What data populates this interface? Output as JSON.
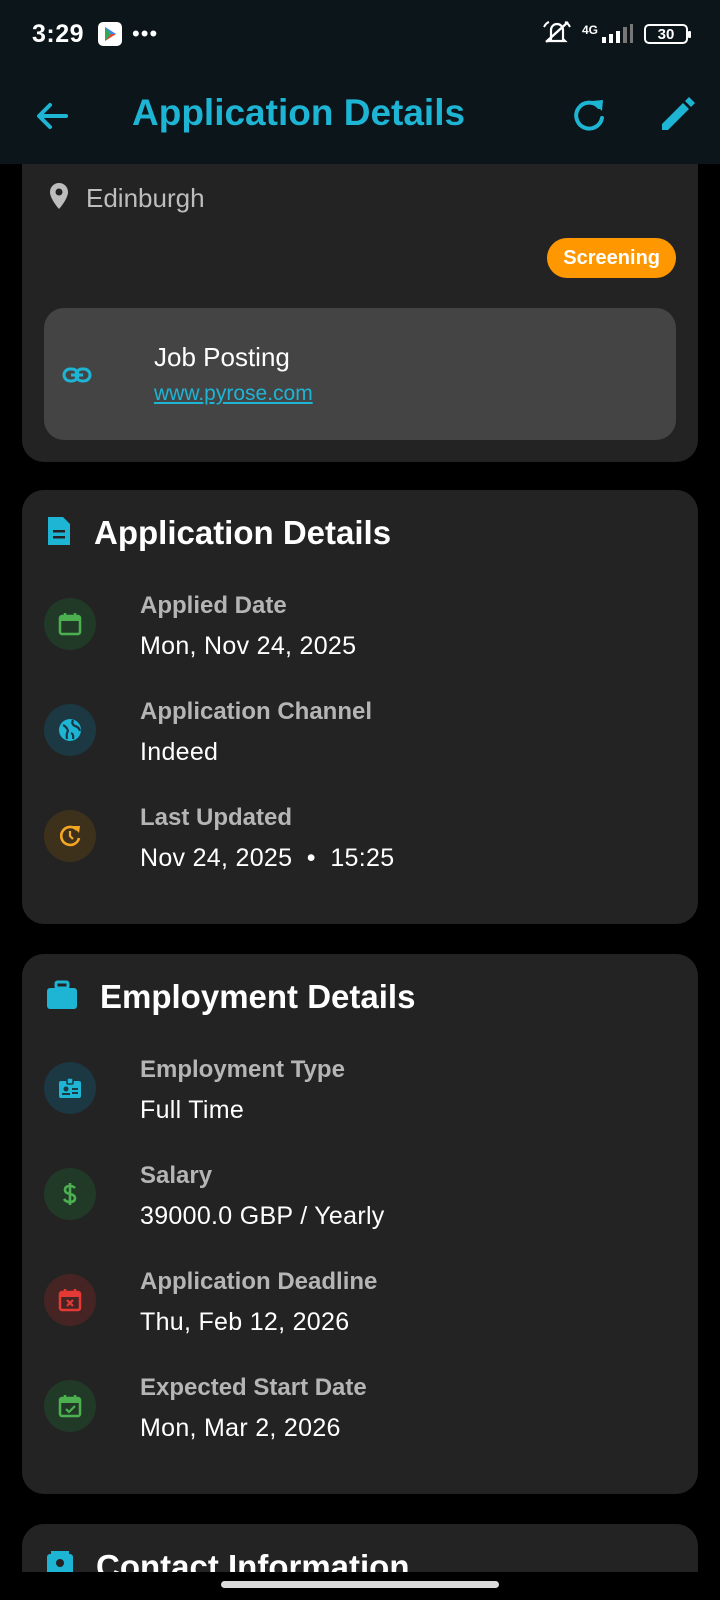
{
  "status_bar": {
    "time": "3:29",
    "dots": "•••",
    "network": "4G",
    "battery": "30"
  },
  "header": {
    "title": "Application Details"
  },
  "job_card": {
    "location": "Edinburgh",
    "status_badge": "Screening",
    "status_color": "#ff9800",
    "posting_title": "Job Posting",
    "posting_url": "www.pyrose.com"
  },
  "application_details": {
    "heading": "Application Details",
    "rows": [
      {
        "label": "Applied Date",
        "value": "Mon, Nov 24, 2025",
        "icon": "calendar-icon"
      },
      {
        "label": "Application Channel",
        "value": "Indeed",
        "icon": "globe-icon"
      },
      {
        "label": "Last Updated",
        "value": "Nov 24, 2025  •  15:25",
        "icon": "update-icon"
      }
    ]
  },
  "employment_details": {
    "heading": "Employment Details",
    "rows": [
      {
        "label": "Employment Type",
        "value": "Full Time",
        "icon": "badge-icon"
      },
      {
        "label": "Salary",
        "value": "39000.0 GBP / Yearly",
        "icon": "dollar-icon"
      },
      {
        "label": "Application Deadline",
        "value": "Thu, Feb 12, 2026",
        "icon": "calendar-x-icon"
      },
      {
        "label": "Expected Start Date",
        "value": "Mon, Mar 2, 2026",
        "icon": "calendar-check-icon"
      }
    ]
  },
  "contact_information": {
    "heading": "Contact Information"
  },
  "colors": {
    "accent": "#1eb4d4",
    "card_bg": "#232323",
    "app_bar_bg": "#0b151a"
  }
}
